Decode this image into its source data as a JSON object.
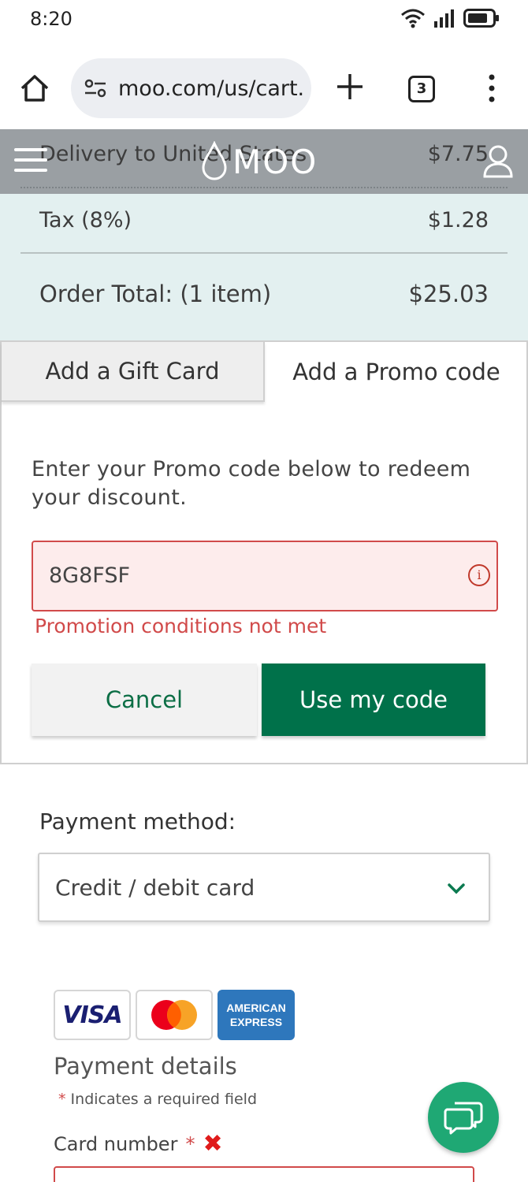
{
  "status_bar": {
    "time": "8:20",
    "battery": "battery-icon",
    "wifi": "wifi-icon",
    "signal": "signal-icon"
  },
  "browser": {
    "url": "moo.com/us/cart.",
    "tab_count": "3"
  },
  "header": {
    "logo_text": "MOO"
  },
  "summary": {
    "delivery_label": "Delivery to United States",
    "delivery_value": "$7.75",
    "tax_label": "Tax (8%)",
    "tax_value": "$1.28",
    "total_label": "Order Total: (1 item)",
    "total_value": "$25.03"
  },
  "tabs": {
    "gift_card": "Add a Gift Card",
    "promo_code": "Add a Promo code",
    "active": "promo_code"
  },
  "promo": {
    "description": "Enter your Promo code below to redeem your discount.",
    "code_value": "8G8FSF",
    "error": "Promotion conditions not met",
    "cancel_label": "Cancel",
    "submit_label": "Use my code"
  },
  "payment": {
    "label": "Payment method:",
    "selected": "Credit / debit card",
    "cards": [
      "VISA",
      "Mastercard",
      "AMERICAN EXPRESS"
    ],
    "details_title": "Payment details",
    "required_note": "Indicates a required field",
    "card_number_label": "Card number"
  },
  "colors": {
    "brand_green": "#00714a",
    "error_red": "#d14a4a",
    "summary_bg": "#e3f0f0",
    "header_grey": "#9a9fa3",
    "chat_green": "#1fa874"
  }
}
